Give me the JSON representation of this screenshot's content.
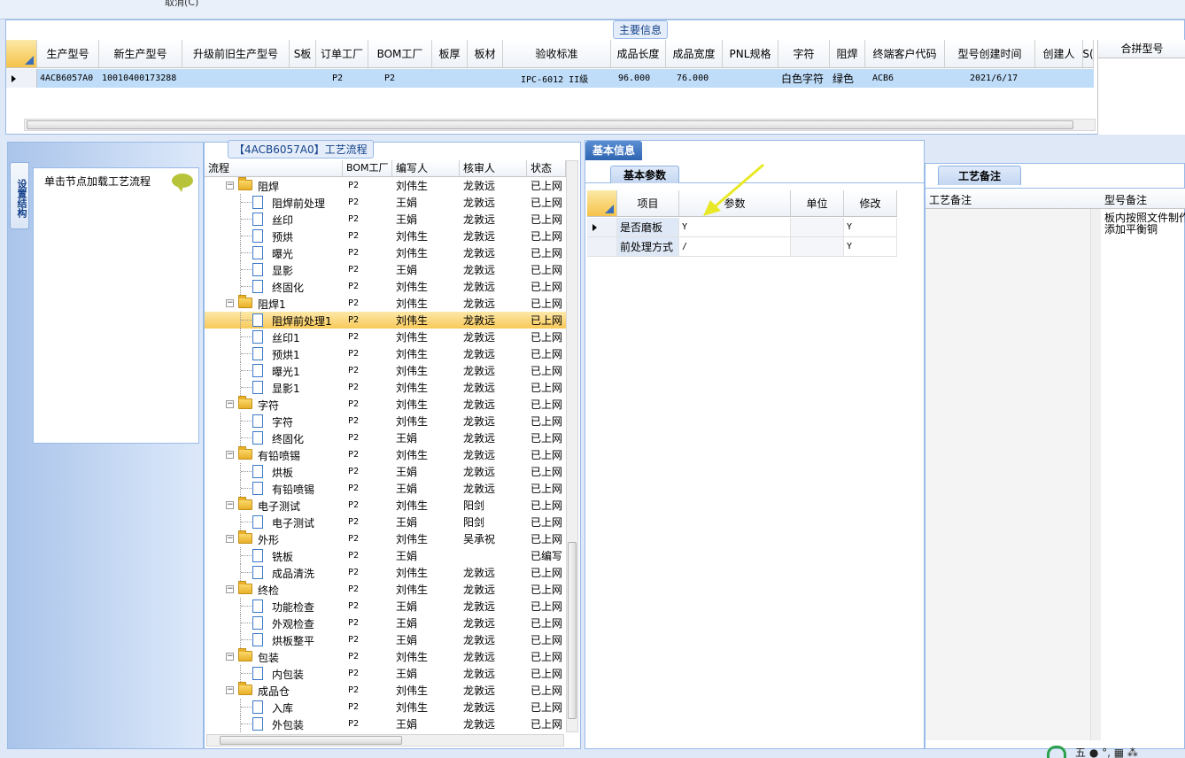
{
  "topbar": {
    "menu_text": "取消(C)"
  },
  "main": {
    "title": "主要信息",
    "columns": [
      "生产型号",
      "新生产型号",
      "升级前旧生产型号",
      "S板",
      "订单工厂",
      "BOM工厂",
      "板厚",
      "板材",
      "验收标准",
      "成品长度",
      "成品宽度",
      "PNL规格",
      "字符",
      "阻焊",
      "终端客户代码",
      "型号创建时间",
      "创建人",
      "S("
    ],
    "merge_column": "合拼型号",
    "row": [
      "4ACB6057A0",
      "10010400173288",
      "",
      "",
      "P2",
      "P2",
      "",
      "",
      "IPC-6012 II级",
      "96.000",
      "76.000",
      "",
      "白色字符",
      "绿色",
      "ACB6",
      "2021/6/17",
      "",
      ""
    ]
  },
  "left_nav": {
    "tab_label": "设置结构",
    "hint": "单击节点加载工艺流程"
  },
  "flow": {
    "title": "【4ACB6057A0】工艺流程",
    "columns": [
      "流程",
      "BOM工厂",
      "编写人",
      "核审人",
      "状态"
    ],
    "rows": [
      {
        "name": "阻焊",
        "bom": "P2",
        "writer": "刘伟生",
        "reviewer": "龙敦远",
        "status": "已上网",
        "group": true
      },
      {
        "name": "阻焊前处理",
        "bom": "P2",
        "writer": "王娟",
        "reviewer": "龙敦远",
        "status": "已上网"
      },
      {
        "name": "丝印",
        "bom": "P2",
        "writer": "王娟",
        "reviewer": "龙敦远",
        "status": "已上网"
      },
      {
        "name": "预烘",
        "bom": "P2",
        "writer": "刘伟生",
        "reviewer": "龙敦远",
        "status": "已上网"
      },
      {
        "name": "曝光",
        "bom": "P2",
        "writer": "刘伟生",
        "reviewer": "龙敦远",
        "status": "已上网"
      },
      {
        "name": "显影",
        "bom": "P2",
        "writer": "王娟",
        "reviewer": "龙敦远",
        "status": "已上网"
      },
      {
        "name": "终固化",
        "bom": "P2",
        "writer": "刘伟生",
        "reviewer": "龙敦远",
        "status": "已上网"
      },
      {
        "name": "阻焊1",
        "bom": "P2",
        "writer": "刘伟生",
        "reviewer": "龙敦远",
        "status": "已上网",
        "group": true
      },
      {
        "name": "阻焊前处理1",
        "bom": "P2",
        "writer": "刘伟生",
        "reviewer": "龙敦远",
        "status": "已上网",
        "selected": true
      },
      {
        "name": "丝印1",
        "bom": "P2",
        "writer": "刘伟生",
        "reviewer": "龙敦远",
        "status": "已上网"
      },
      {
        "name": "预烘1",
        "bom": "P2",
        "writer": "刘伟生",
        "reviewer": "龙敦远",
        "status": "已上网"
      },
      {
        "name": "曝光1",
        "bom": "P2",
        "writer": "刘伟生",
        "reviewer": "龙敦远",
        "status": "已上网"
      },
      {
        "name": "显影1",
        "bom": "P2",
        "writer": "刘伟生",
        "reviewer": "龙敦远",
        "status": "已上网"
      },
      {
        "name": "字符",
        "bom": "P2",
        "writer": "刘伟生",
        "reviewer": "龙敦远",
        "status": "已上网",
        "group": true
      },
      {
        "name": "字符",
        "bom": "P2",
        "writer": "刘伟生",
        "reviewer": "龙敦远",
        "status": "已上网"
      },
      {
        "name": "终固化",
        "bom": "P2",
        "writer": "王娟",
        "reviewer": "龙敦远",
        "status": "已上网"
      },
      {
        "name": "有铅喷锡",
        "bom": "P2",
        "writer": "刘伟生",
        "reviewer": "龙敦远",
        "status": "已上网",
        "group": true
      },
      {
        "name": "烘板",
        "bom": "P2",
        "writer": "王娟",
        "reviewer": "龙敦远",
        "status": "已上网"
      },
      {
        "name": "有铅喷锡",
        "bom": "P2",
        "writer": "王娟",
        "reviewer": "龙敦远",
        "status": "已上网"
      },
      {
        "name": "电子测试",
        "bom": "P2",
        "writer": "刘伟生",
        "reviewer": "阳剑",
        "status": "已上网",
        "group": true
      },
      {
        "name": "电子测试",
        "bom": "P2",
        "writer": "王娟",
        "reviewer": "阳剑",
        "status": "已上网"
      },
      {
        "name": "外形",
        "bom": "P2",
        "writer": "刘伟生",
        "reviewer": "吴承祝",
        "status": "已上网",
        "group": true
      },
      {
        "name": "铣板",
        "bom": "P2",
        "writer": "王娟",
        "reviewer": "",
        "status": "已编写"
      },
      {
        "name": "成品清洗",
        "bom": "P2",
        "writer": "刘伟生",
        "reviewer": "龙敦远",
        "status": "已上网"
      },
      {
        "name": "终检",
        "bom": "P2",
        "writer": "刘伟生",
        "reviewer": "龙敦远",
        "status": "已上网",
        "group": true
      },
      {
        "name": "功能检查",
        "bom": "P2",
        "writer": "王娟",
        "reviewer": "龙敦远",
        "status": "已上网"
      },
      {
        "name": "外观检查",
        "bom": "P2",
        "writer": "王娟",
        "reviewer": "龙敦远",
        "status": "已上网"
      },
      {
        "name": "烘板整平",
        "bom": "P2",
        "writer": "王娟",
        "reviewer": "龙敦远",
        "status": "已上网"
      },
      {
        "name": "包装",
        "bom": "P2",
        "writer": "刘伟生",
        "reviewer": "龙敦远",
        "status": "已上网",
        "group": true
      },
      {
        "name": "内包装",
        "bom": "P2",
        "writer": "王娟",
        "reviewer": "龙敦远",
        "status": "已上网"
      },
      {
        "name": "成品仓",
        "bom": "P2",
        "writer": "刘伟生",
        "reviewer": "龙敦远",
        "status": "已上网",
        "group": true
      },
      {
        "name": "入库",
        "bom": "P2",
        "writer": "刘伟生",
        "reviewer": "龙敦远",
        "status": "已上网"
      },
      {
        "name": "外包装",
        "bom": "P2",
        "writer": "王娟",
        "reviewer": "龙敦远",
        "status": "已上网"
      }
    ]
  },
  "basic": {
    "panel_tab": "基本信息",
    "sub_tab": "基本参数",
    "columns": [
      "项目",
      "参数",
      "单位",
      "修改"
    ],
    "rows": [
      {
        "item": "是否磨板",
        "param": "Y",
        "unit": "",
        "modify": "Y"
      },
      {
        "item": "前处理方式",
        "param": "/",
        "unit": "",
        "modify": "Y"
      }
    ]
  },
  "notes": {
    "tab": "工艺备注",
    "col1": "工艺备注",
    "col2": "型号备注",
    "text_line1": "板内按照文件制作",
    "text_line2": "添加平衡铜"
  },
  "statusbar": {
    "text": "五 ● °, ▦ ⁂"
  },
  "colors": {
    "selection_row": "#bfdcf8",
    "selected_tree_row": "#f8c95a",
    "accent_blue": "#2f65b1",
    "arrow": "#e8e826"
  }
}
